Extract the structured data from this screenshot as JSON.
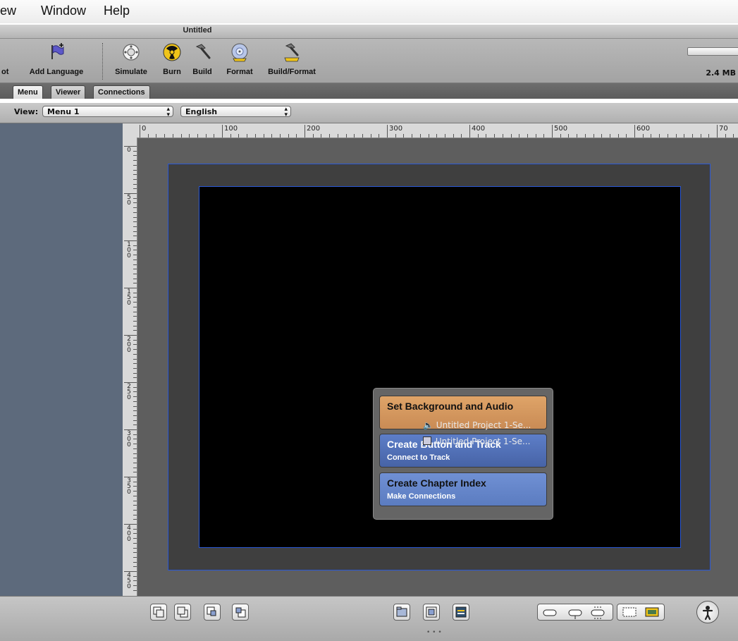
{
  "menubar": {
    "items": [
      "ew",
      "Window",
      "Help"
    ]
  },
  "window": {
    "title": "Untitled"
  },
  "toolbar": {
    "buttons": [
      "ot",
      "Add Language",
      "Simulate",
      "Burn",
      "Build",
      "Format",
      "Build/Format"
    ],
    "memory": "2.4 MB",
    "memory_fraction": 0.0
  },
  "tabs": [
    "Menu",
    "Viewer",
    "Connections"
  ],
  "viewbar": {
    "label": "View:",
    "menu": "Menu 1",
    "language": "English"
  },
  "ruler": {
    "h_labels": [
      "0",
      "100",
      "200",
      "300",
      "400",
      "500",
      "600",
      "70"
    ],
    "v_labels": [
      "0",
      "50",
      "100",
      "150",
      "200",
      "250",
      "300",
      "350",
      "400",
      "450"
    ]
  },
  "hud": {
    "b1_title": "Set Background and Audio",
    "b2_title": "Create Button and Track",
    "b2_sub": "Connect to Track",
    "b3_title": "Create Chapter Index",
    "b3_sub": "Make Connections",
    "drop1": "Untitled Project 1-Se...",
    "drop2": "Untitled Project 1-Se..."
  },
  "colors": {
    "accent_blue": "#2a58d6",
    "hud_orange": "#d7955e",
    "hud_blue": "#5a79c2"
  }
}
